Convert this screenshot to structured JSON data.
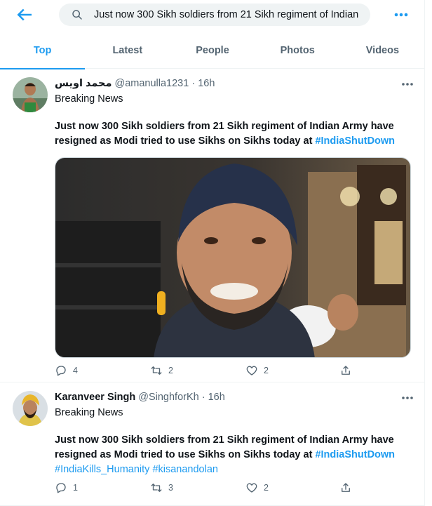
{
  "search": {
    "query": "Just now 300 Sikh soldiers from 21 Sikh regiment of Indian"
  },
  "tabs": [
    {
      "label": "Top",
      "active": true
    },
    {
      "label": "Latest",
      "active": false
    },
    {
      "label": "People",
      "active": false
    },
    {
      "label": "Photos",
      "active": false
    },
    {
      "label": "Videos",
      "active": false
    }
  ],
  "tweets": [
    {
      "name": "محمد اویس",
      "handle": "@amanulla1231",
      "dot": " · ",
      "time": "16h",
      "context": "Breaking News",
      "text": "Just now 300 Sikh soldiers from 21 Sikh regiment of Indian Army have resigned as Modi tried to use Sikhs on Sikhs today at ",
      "hashtag": "#IndiaShutDown",
      "replies": "4",
      "retweets": "2",
      "likes": "2"
    },
    {
      "name": "Karanveer Singh",
      "handle": "@SinghforKh",
      "dot": " · ",
      "time": "16h",
      "context": "Breaking News",
      "text": "Just now 300 Sikh soldiers from 21 Sikh regiment of Indian Army have resigned as Modi tried to use Sikhs on Sikhs today at ",
      "hashtag": "#IndiaShutDown",
      "hashtag2": "#IndiaKills_Humanity",
      "hashtag3": "#kisanandolan",
      "replies": "1",
      "retweets": "3",
      "likes": "2"
    }
  ],
  "colors": {
    "accent": "#1d9bf0",
    "secondary_text": "#536471",
    "divider": "#eff3f4",
    "search_bg": "#eff3f4"
  },
  "icons": [
    "back-arrow-icon",
    "search-icon",
    "more-icon",
    "reply-icon",
    "retweet-icon",
    "like-icon",
    "share-icon"
  ]
}
